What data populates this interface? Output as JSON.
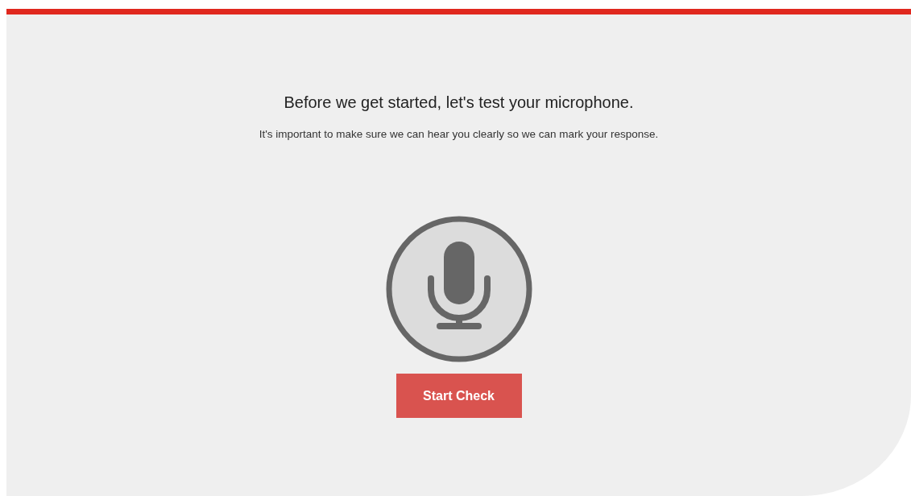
{
  "heading": "Before we get started, let's test your microphone.",
  "subtitle": "It's important to make sure we can hear you clearly so we can mark your response.",
  "button": {
    "label": "Start Check"
  }
}
